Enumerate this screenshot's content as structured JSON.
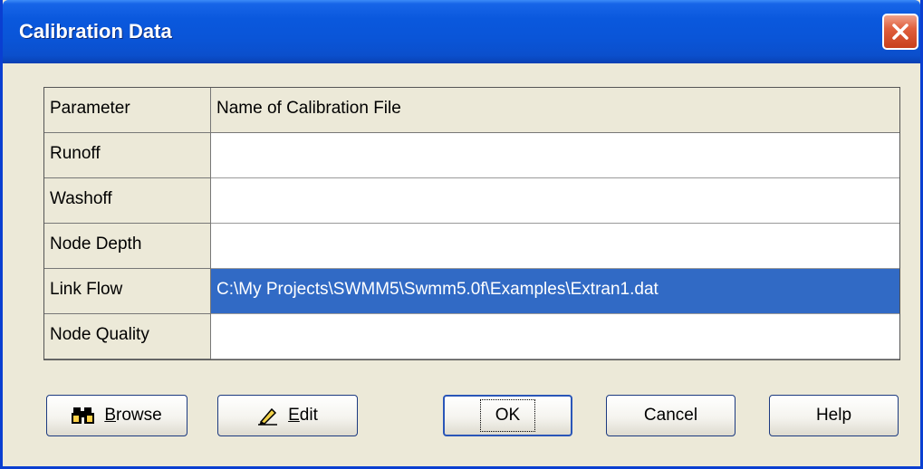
{
  "window": {
    "title": "Calibration Data"
  },
  "grid": {
    "headers": {
      "parameter": "Parameter",
      "file": "Name of Calibration File"
    },
    "rows": [
      {
        "parameter": "Runoff",
        "file": ""
      },
      {
        "parameter": "Washoff",
        "file": ""
      },
      {
        "parameter": "Node Depth",
        "file": ""
      },
      {
        "parameter": "Link Flow",
        "file": "C:\\My Projects\\SWMM5\\Swmm5.0f\\Examples\\Extran1.dat"
      },
      {
        "parameter": "Node Quality",
        "file": ""
      }
    ]
  },
  "buttons": {
    "browse": {
      "accel": "B",
      "rest": "rowse"
    },
    "edit": {
      "accel": "E",
      "rest": "dit"
    },
    "ok": "OK",
    "cancel": "Cancel",
    "help": "Help"
  },
  "colors": {
    "selection": "#316ac5",
    "titlebar": "#0a55d8",
    "face": "#ece9d8"
  },
  "icons": [
    "close-icon",
    "binoculars-icon",
    "pencil-icon"
  ]
}
